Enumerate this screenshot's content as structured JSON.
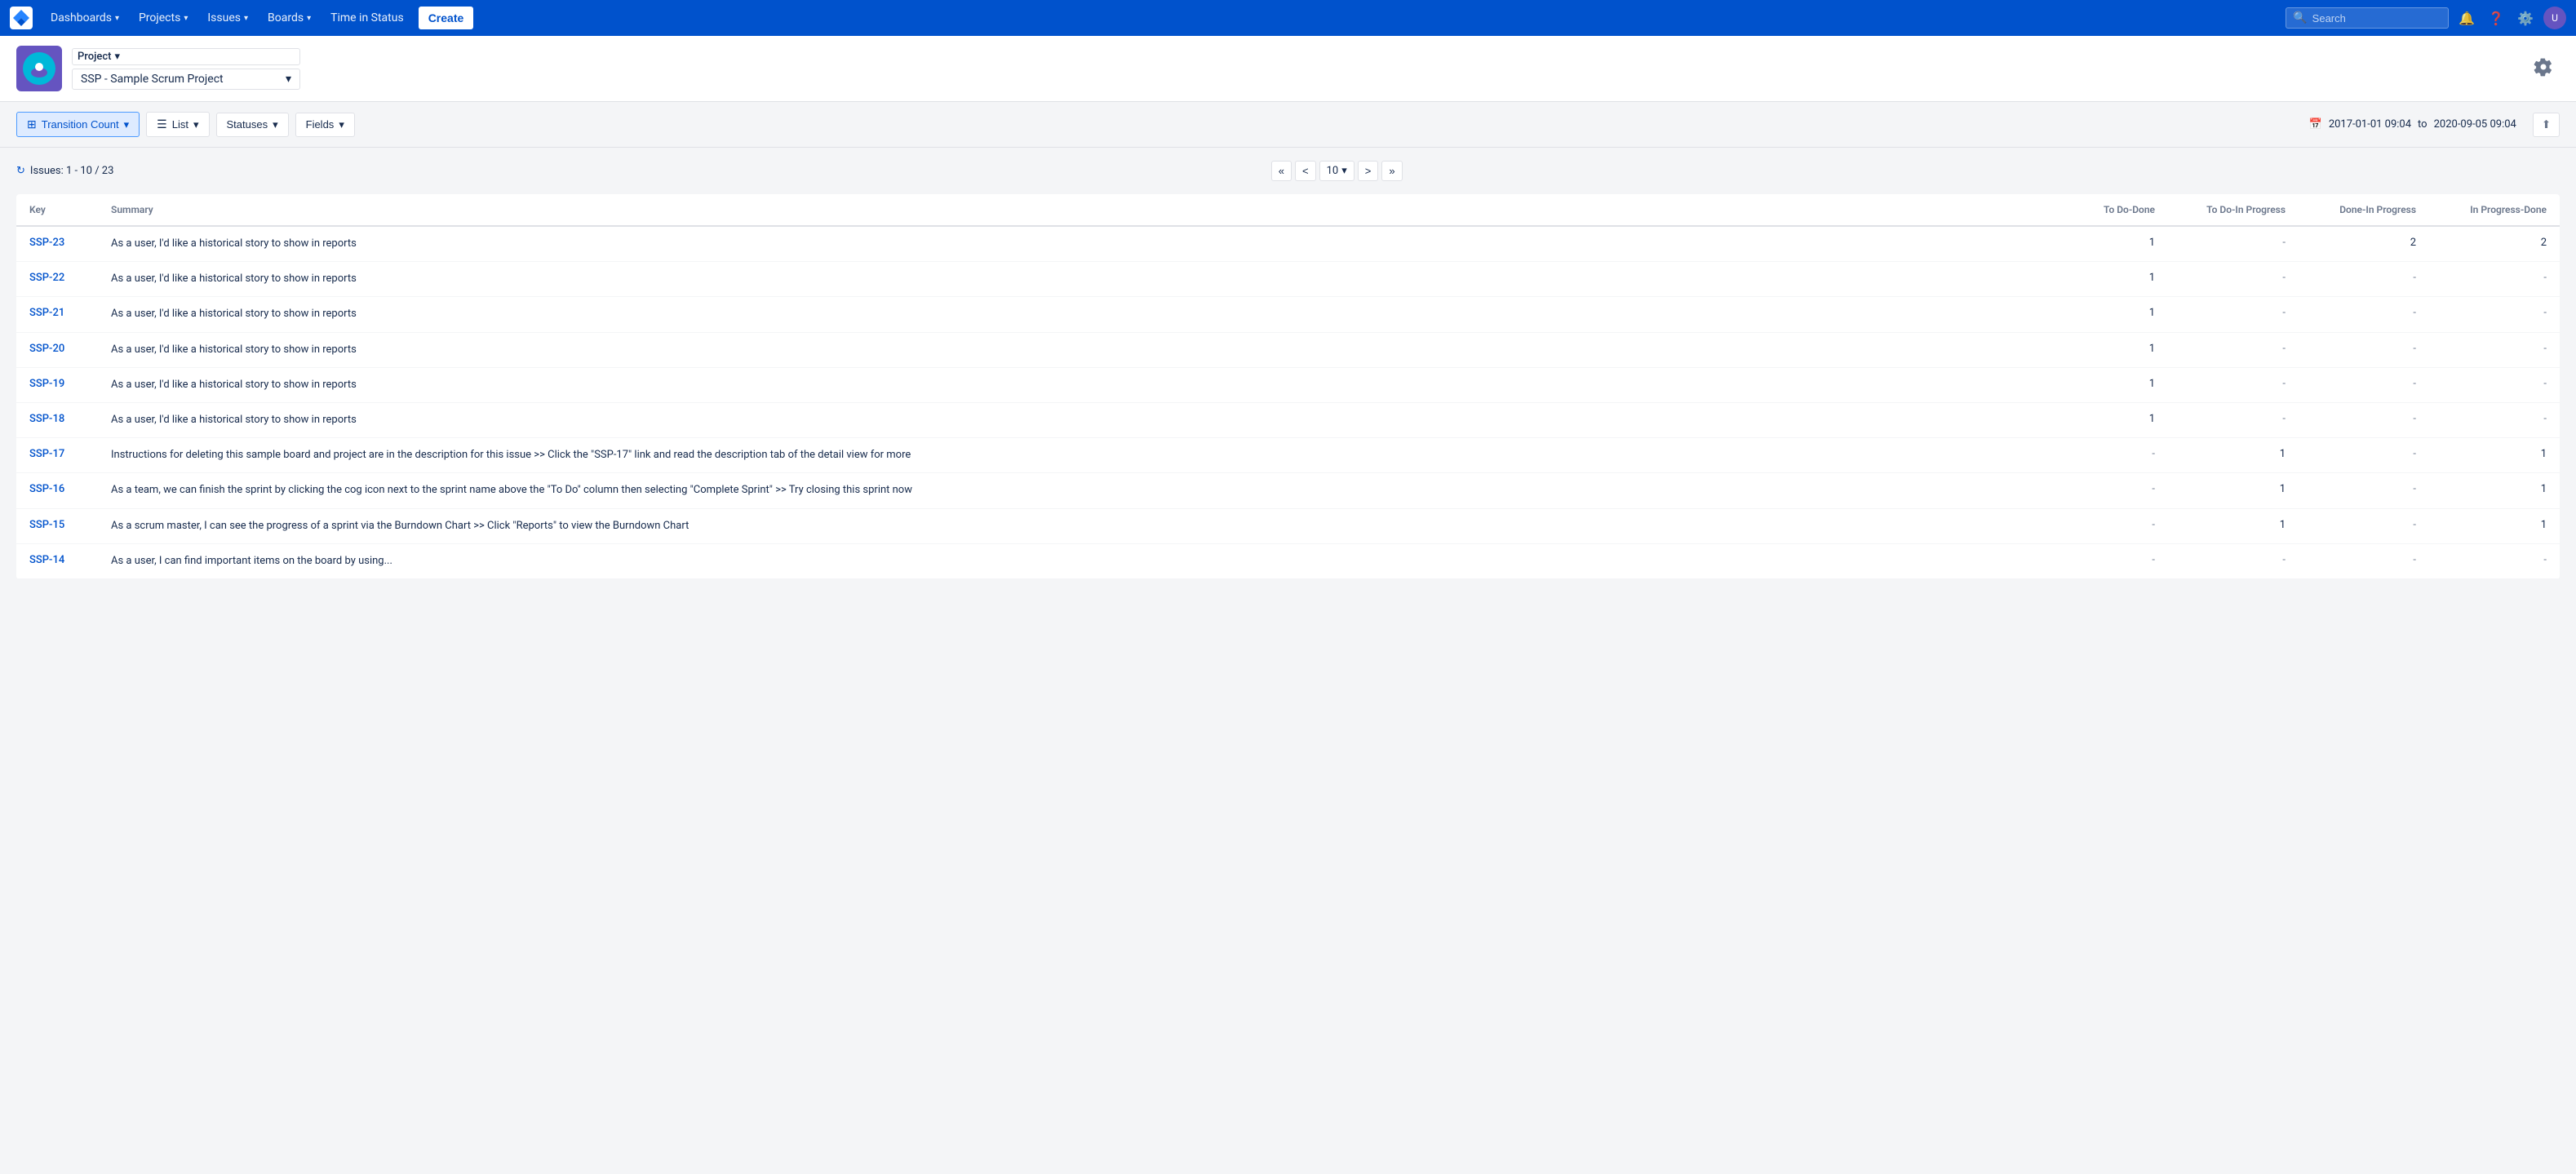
{
  "navbar": {
    "logo_alt": "Jira",
    "items": [
      {
        "label": "Dashboards",
        "has_chevron": true
      },
      {
        "label": "Projects",
        "has_chevron": true
      },
      {
        "label": "Issues",
        "has_chevron": true
      },
      {
        "label": "Boards",
        "has_chevron": true
      },
      {
        "label": "Time in Status",
        "has_chevron": false
      }
    ],
    "create_label": "Create",
    "search_placeholder": "Search"
  },
  "project": {
    "type_label": "Project",
    "name": "SSP - Sample Scrum Project"
  },
  "toolbar": {
    "report_label": "Transition Count",
    "view_label": "List",
    "statuses_label": "Statuses",
    "fields_label": "Fields",
    "date_from": "2017-01-01 09:04",
    "date_to": "2020-09-05 09:04",
    "date_separator": "to"
  },
  "issues_bar": {
    "count_text": "Issues: 1 - 10 / 23",
    "page_size": "10",
    "page_first": "«",
    "page_prev": "<",
    "page_next": ">",
    "page_last": "»"
  },
  "table": {
    "columns": [
      "Key",
      "Summary",
      "To Do-Done",
      "To Do-In Progress",
      "Done-In Progress",
      "In Progress-Done"
    ],
    "rows": [
      {
        "key": "SSP-23",
        "summary": "As a user, I'd like a historical story to show in reports",
        "todo_done": "1",
        "todo_inprog": "-",
        "done_inprog": "2",
        "inprog_done": "2"
      },
      {
        "key": "SSP-22",
        "summary": "As a user, I'd like a historical story to show in reports",
        "todo_done": "1",
        "todo_inprog": "-",
        "done_inprog": "-",
        "inprog_done": "-"
      },
      {
        "key": "SSP-21",
        "summary": "As a user, I'd like a historical story to show in reports",
        "todo_done": "1",
        "todo_inprog": "-",
        "done_inprog": "-",
        "inprog_done": "-"
      },
      {
        "key": "SSP-20",
        "summary": "As a user, I'd like a historical story to show in reports",
        "todo_done": "1",
        "todo_inprog": "-",
        "done_inprog": "-",
        "inprog_done": "-"
      },
      {
        "key": "SSP-19",
        "summary": "As a user, I'd like a historical story to show in reports",
        "todo_done": "1",
        "todo_inprog": "-",
        "done_inprog": "-",
        "inprog_done": "-"
      },
      {
        "key": "SSP-18",
        "summary": "As a user, I'd like a historical story to show in reports",
        "todo_done": "1",
        "todo_inprog": "-",
        "done_inprog": "-",
        "inprog_done": "-"
      },
      {
        "key": "SSP-17",
        "summary": "Instructions for deleting this sample board and project are in the description for this issue >> Click the \"SSP-17\" link and read the description tab of the detail view for more",
        "todo_done": "-",
        "todo_inprog": "1",
        "done_inprog": "-",
        "inprog_done": "1"
      },
      {
        "key": "SSP-16",
        "summary": "As a team, we can finish the sprint by clicking the cog icon next to the sprint name above the \"To Do\" column then selecting \"Complete Sprint\" >> Try closing this sprint now",
        "todo_done": "-",
        "todo_inprog": "1",
        "done_inprog": "-",
        "inprog_done": "1"
      },
      {
        "key": "SSP-15",
        "summary": "As a scrum master, I can see the progress of a sprint via the Burndown Chart >> Click \"Reports\" to view the Burndown Chart",
        "todo_done": "-",
        "todo_inprog": "1",
        "done_inprog": "-",
        "inprog_done": "1"
      },
      {
        "key": "SSP-14",
        "summary": "As a user, I can find important items on the board by using...",
        "todo_done": "-",
        "todo_inprog": "-",
        "done_inprog": "-",
        "inprog_done": "-"
      }
    ]
  }
}
